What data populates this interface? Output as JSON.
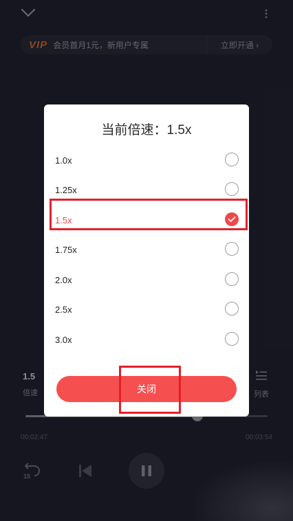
{
  "vip_banner": {
    "logo": "VIP",
    "text": "会员首月1元，新用户专属",
    "cta": "立即开通 ›"
  },
  "player": {
    "speed_value": "1.5",
    "speed_label": "倍速",
    "list_label": "列表",
    "current_time": "00:02:47",
    "total_time": "00:03:54",
    "progress": 0.71
  },
  "modal": {
    "title": "当前倍速：1.5x",
    "options": [
      {
        "label": "1.0x",
        "selected": false
      },
      {
        "label": "1.25x",
        "selected": false
      },
      {
        "label": "1.5x",
        "selected": true
      },
      {
        "label": "1.75x",
        "selected": false
      },
      {
        "label": "2.0x",
        "selected": false
      },
      {
        "label": "2.5x",
        "selected": false
      },
      {
        "label": "3.0x",
        "selected": false
      }
    ],
    "close_label": "关闭"
  },
  "colors": {
    "accent": "#f0474b",
    "annotation_box": "#e1202b",
    "background": "#1d1e28"
  },
  "icons": {
    "top_left": "chevron-down-icon",
    "top_right": "more-vertical-icon",
    "list": "playlist-icon",
    "rewind": "rewind-15-icon",
    "previous": "skip-previous-icon",
    "pause": "pause-icon",
    "selected": "checkmark-icon"
  }
}
